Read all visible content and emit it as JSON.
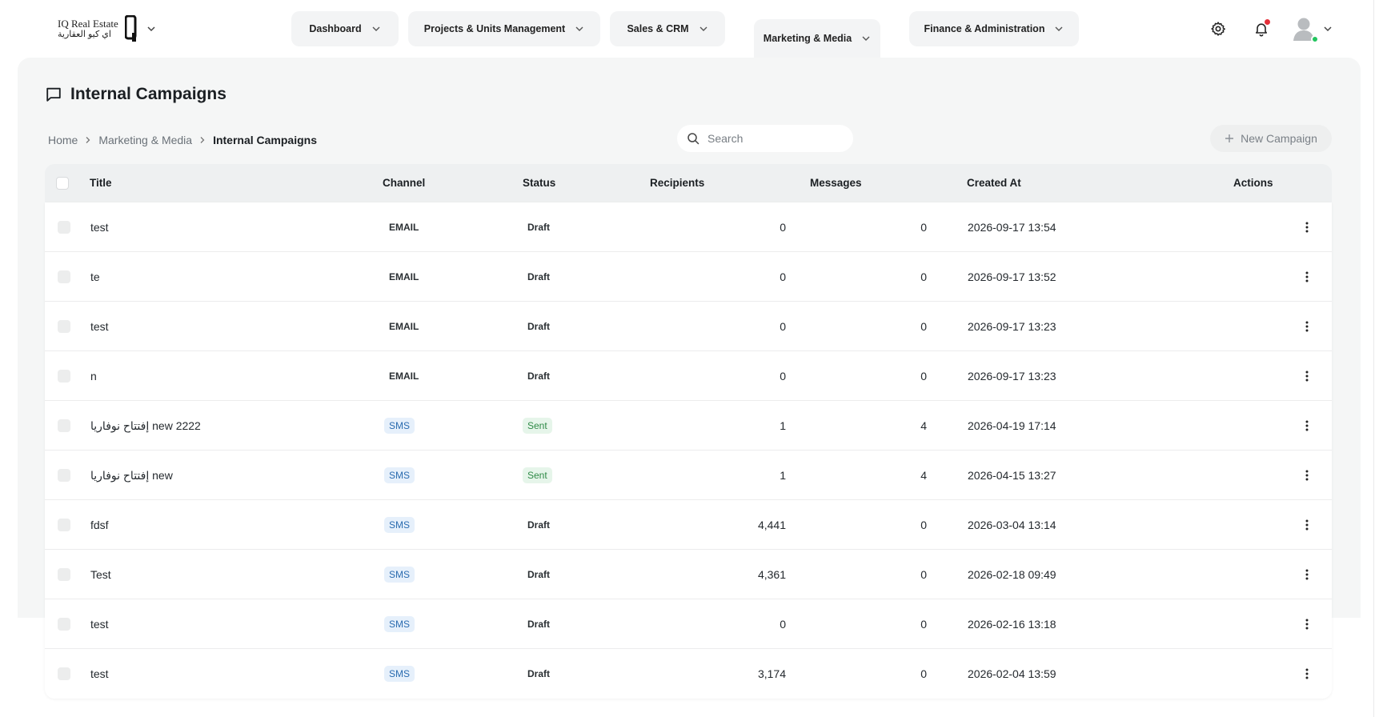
{
  "brand": {
    "name_en": "IQ Real Estate",
    "name_ar": "اي كيو العقارية"
  },
  "nav": {
    "tabs": [
      {
        "label": "Dashboard",
        "active": false
      },
      {
        "label": "Projects & Units Management",
        "active": false
      },
      {
        "label": "Sales & CRM",
        "active": false
      },
      {
        "label": "Marketing & Media",
        "active": true
      },
      {
        "label": "Finance & Administration",
        "active": false
      }
    ]
  },
  "page": {
    "title": "Internal Campaigns",
    "breadcrumb": [
      "Home",
      "Marketing & Media",
      "Internal Campaigns"
    ]
  },
  "search": {
    "placeholder": "Search",
    "value": ""
  },
  "actions": {
    "new_campaign": "New Campaign"
  },
  "table": {
    "columns": [
      "Title",
      "Channel",
      "Status",
      "Recipients",
      "Messages",
      "Created At",
      "Actions"
    ],
    "rows": [
      {
        "title": "test",
        "channel": "EMAIL",
        "status": "Draft",
        "recipients": "0",
        "messages": "0",
        "created_at": "2026-09-17 13:54"
      },
      {
        "title": "te",
        "channel": "EMAIL",
        "status": "Draft",
        "recipients": "0",
        "messages": "0",
        "created_at": "2026-09-17 13:52"
      },
      {
        "title": "test",
        "channel": "EMAIL",
        "status": "Draft",
        "recipients": "0",
        "messages": "0",
        "created_at": "2026-09-17 13:23"
      },
      {
        "title": "n",
        "channel": "EMAIL",
        "status": "Draft",
        "recipients": "0",
        "messages": "0",
        "created_at": "2026-09-17 13:23"
      },
      {
        "title": "إفتتاح نوفاريا new 2222",
        "channel": "SMS",
        "status": "Sent",
        "recipients": "1",
        "messages": "4",
        "created_at": "2026-04-19 17:14"
      },
      {
        "title": "إفتتاح نوفاريا new",
        "channel": "SMS",
        "status": "Sent",
        "recipients": "1",
        "messages": "4",
        "created_at": "2026-04-15 13:27"
      },
      {
        "title": "fdsf",
        "channel": "SMS",
        "status": "Draft",
        "recipients": "4,441",
        "messages": "0",
        "created_at": "2026-03-04 13:14"
      },
      {
        "title": "Test",
        "channel": "SMS",
        "status": "Draft",
        "recipients": "4,361",
        "messages": "0",
        "created_at": "2026-02-18 09:49"
      },
      {
        "title": "test",
        "channel": "SMS",
        "status": "Draft",
        "recipients": "0",
        "messages": "0",
        "created_at": "2026-02-16 13:18"
      },
      {
        "title": "test",
        "channel": "SMS",
        "status": "Draft",
        "recipients": "3,174",
        "messages": "0",
        "created_at": "2026-02-04 13:59"
      }
    ]
  },
  "colors": {
    "panel_bg": "#f5f6f6",
    "sms_badge": "#2b6cb0",
    "sent_badge": "#2f8a47",
    "notification_dot": "#e5303a",
    "online_dot": "#22c55e"
  }
}
